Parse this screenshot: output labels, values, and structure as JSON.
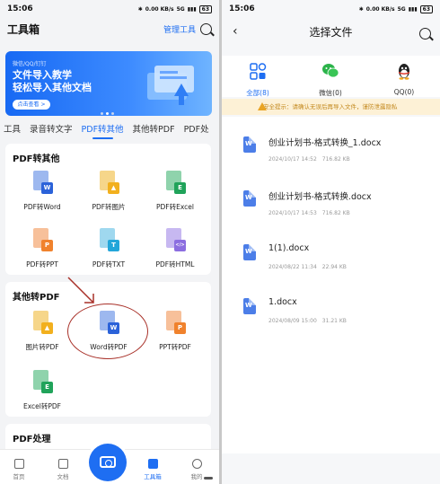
{
  "left": {
    "status": {
      "time": "15:06",
      "speed": "0.00 KB/s",
      "network": "5G",
      "battery": "63"
    },
    "header": {
      "title": "工具箱",
      "manage": "管理工具"
    },
    "banner": {
      "small": "微信/QQ/钉钉",
      "line1": "文件导入教学",
      "line2": "轻松导入其他文档",
      "button": "点击查看 >"
    },
    "tabs": [
      "工具",
      "录音转文字",
      "PDF转其他",
      "其他转PDF",
      "PDF处"
    ],
    "pdf_to_other": {
      "title": "PDF转其他",
      "tools": [
        {
          "label": "PDF转Word",
          "badge": "W",
          "color": "#2b62d9"
        },
        {
          "label": "PDF转图片",
          "badge": "▲",
          "color": "#f2b01e"
        },
        {
          "label": "PDF转Excel",
          "badge": "E",
          "color": "#20a35a"
        },
        {
          "label": "PDF转PPT",
          "badge": "P",
          "color": "#f0822d"
        },
        {
          "label": "PDF转TXT",
          "badge": "T",
          "color": "#23a6d9"
        },
        {
          "label": "PDF转HTML",
          "badge": "</>",
          "color": "#8c6ee0"
        }
      ]
    },
    "other_to_pdf": {
      "title": "其他转PDF",
      "tools": [
        {
          "label": "图片转PDF",
          "badge": "▲",
          "color": "#f2b01e"
        },
        {
          "label": "Word转PDF",
          "badge": "W",
          "color": "#2b62d9"
        },
        {
          "label": "PPT转PDF",
          "badge": "P",
          "color": "#f0822d"
        },
        {
          "label": "Excel转PDF",
          "badge": "E",
          "color": "#20a35a"
        }
      ]
    },
    "pdf_process": {
      "title": "PDF处理"
    },
    "nav": {
      "home": "首页",
      "docs": "文档",
      "toolbox": "工具箱",
      "mine": "我的"
    }
  },
  "right": {
    "status": {
      "time": "15:06",
      "speed": "0.00 KB/s",
      "network": "5G",
      "battery": "63"
    },
    "title": "选择文件",
    "categories": [
      {
        "label": "全部(8)"
      },
      {
        "label": "微信(0)"
      },
      {
        "label": "QQ(0)"
      }
    ],
    "warning": "安全提示：请确认无误后再导入文件，谨防泄露隐私",
    "files": [
      {
        "name": "创业计划书-格式转换_1.docx",
        "date": "2024/10/17 14:52",
        "size": "716.82 KB"
      },
      {
        "name": "创业计划书-格式转换.docx",
        "date": "2024/10/17 14:53",
        "size": "716.82 KB"
      },
      {
        "name": "1(1).docx",
        "date": "2024/08/22 11:34",
        "size": "22.94 KB"
      },
      {
        "name": "1.docx",
        "date": "2024/08/09 15:00",
        "size": "31.21 KB"
      }
    ]
  }
}
